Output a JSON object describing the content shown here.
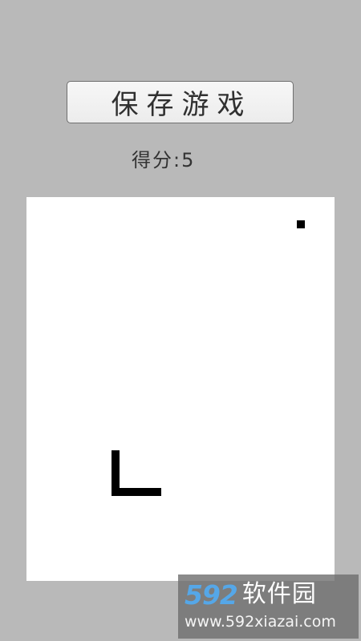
{
  "header": {
    "save_button_label": "保存游戏"
  },
  "score": {
    "label": "得分",
    "separator": ":",
    "value": "5"
  },
  "board": {
    "background_color": "#ffffff",
    "food_color": "#000000",
    "snake_color": "#000000"
  },
  "watermark": {
    "brand_number": "592",
    "brand_text": "软件园",
    "url": "www.592xiazai.com"
  }
}
